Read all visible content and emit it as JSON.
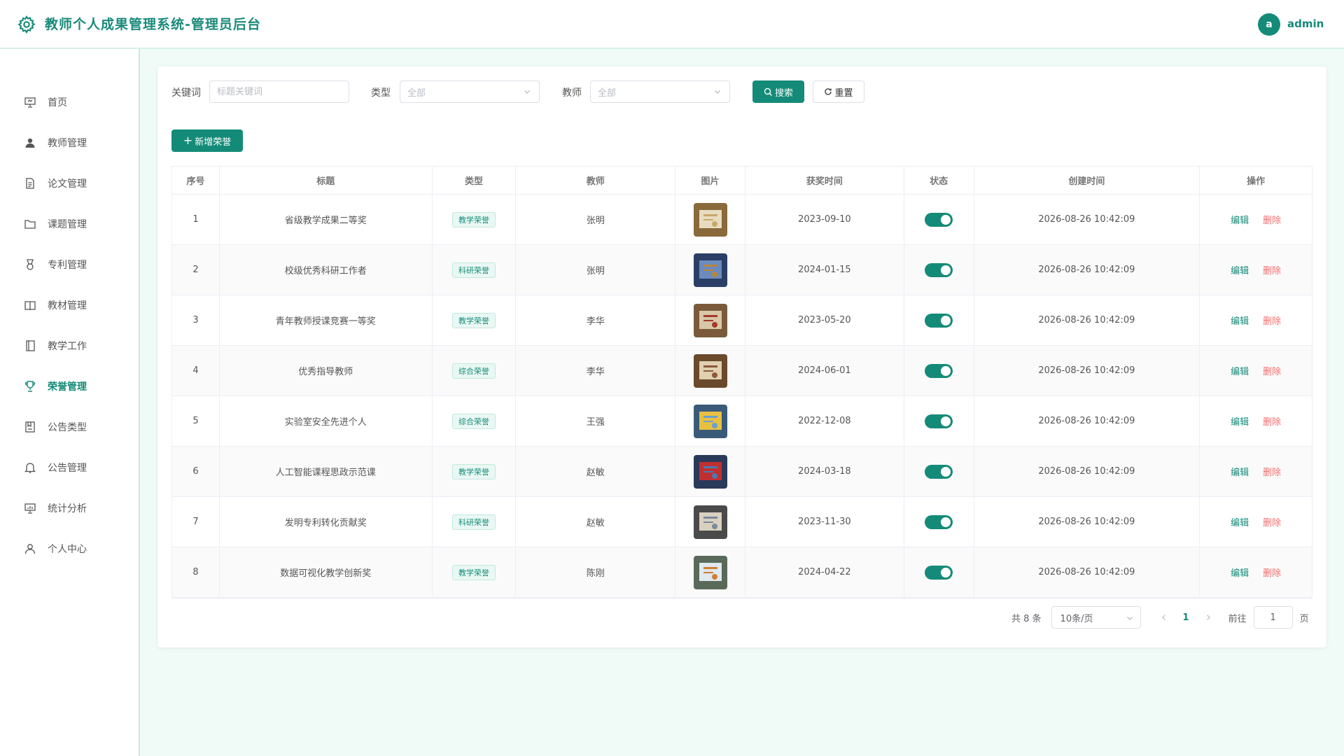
{
  "header": {
    "title": "教师个人成果管理系统-管理员后台",
    "avatar_letter": "a",
    "username": "admin"
  },
  "sidebar": {
    "items": [
      {
        "label": "首页",
        "icon": "presentation-icon"
      },
      {
        "label": "教师管理",
        "icon": "user-icon"
      },
      {
        "label": "论文管理",
        "icon": "document-icon"
      },
      {
        "label": "课题管理",
        "icon": "folder-icon"
      },
      {
        "label": "专利管理",
        "icon": "medal-icon"
      },
      {
        "label": "教材管理",
        "icon": "book-icon"
      },
      {
        "label": "教学工作",
        "icon": "notebook-icon"
      },
      {
        "label": "荣誉管理",
        "icon": "trophy-icon",
        "active": true
      },
      {
        "label": "公告类型",
        "icon": "collection-icon"
      },
      {
        "label": "公告管理",
        "icon": "bell-icon"
      },
      {
        "label": "统计分析",
        "icon": "data-board-icon"
      },
      {
        "label": "个人中心",
        "icon": "user-outline-icon"
      }
    ]
  },
  "filters": {
    "keyword_label": "关键词",
    "keyword_placeholder": "标题关键词",
    "keyword_value": "",
    "type_label": "类型",
    "type_value": "全部",
    "teacher_label": "教师",
    "teacher_value": "全部",
    "search_label": "搜索",
    "reset_label": "重置"
  },
  "add_button_label": "新增荣誉",
  "table": {
    "columns": [
      "序号",
      "标题",
      "类型",
      "教师",
      "图片",
      "获奖时间",
      "状态",
      "创建时间",
      "操作"
    ],
    "rows": [
      {
        "index": "1",
        "title": "省级教学成果二等奖",
        "type": "教学荣誉",
        "teacher": "张明",
        "award_date": "2023-09-10",
        "status": true,
        "created": "2026-08-26 10:42:09"
      },
      {
        "index": "2",
        "title": "校级优秀科研工作者",
        "type": "科研荣誉",
        "teacher": "张明",
        "award_date": "2024-01-15",
        "status": true,
        "created": "2026-08-26 10:42:09"
      },
      {
        "index": "3",
        "title": "青年教师授课竞赛一等奖",
        "type": "教学荣誉",
        "teacher": "李华",
        "award_date": "2023-05-20",
        "status": true,
        "created": "2026-08-26 10:42:09"
      },
      {
        "index": "4",
        "title": "优秀指导教师",
        "type": "综合荣誉",
        "teacher": "李华",
        "award_date": "2024-06-01",
        "status": true,
        "created": "2026-08-26 10:42:09"
      },
      {
        "index": "5",
        "title": "实验室安全先进个人",
        "type": "综合荣誉",
        "teacher": "王强",
        "award_date": "2022-12-08",
        "status": true,
        "created": "2026-08-26 10:42:09"
      },
      {
        "index": "6",
        "title": "人工智能课程思政示范课",
        "type": "教学荣誉",
        "teacher": "赵敏",
        "award_date": "2024-03-18",
        "status": true,
        "created": "2026-08-26 10:42:09"
      },
      {
        "index": "7",
        "title": "发明专利转化贡献奖",
        "type": "科研荣誉",
        "teacher": "赵敏",
        "award_date": "2023-11-30",
        "status": true,
        "created": "2026-08-26 10:42:09"
      },
      {
        "index": "8",
        "title": "数据可视化教学创新奖",
        "type": "教学荣誉",
        "teacher": "陈刚",
        "award_date": "2024-04-22",
        "status": true,
        "created": "2026-08-26 10:42:09"
      }
    ],
    "edit_label": "编辑",
    "delete_label": "删除"
  },
  "pagination": {
    "total_text": "共 8 条",
    "page_size": "10条/页",
    "current_page": "1",
    "goto_label": "前往",
    "goto_value": "1",
    "page_suffix": "页"
  },
  "colors": {
    "primary": "#148b78",
    "danger": "#f56c6c",
    "background": "#f0fbf8"
  }
}
